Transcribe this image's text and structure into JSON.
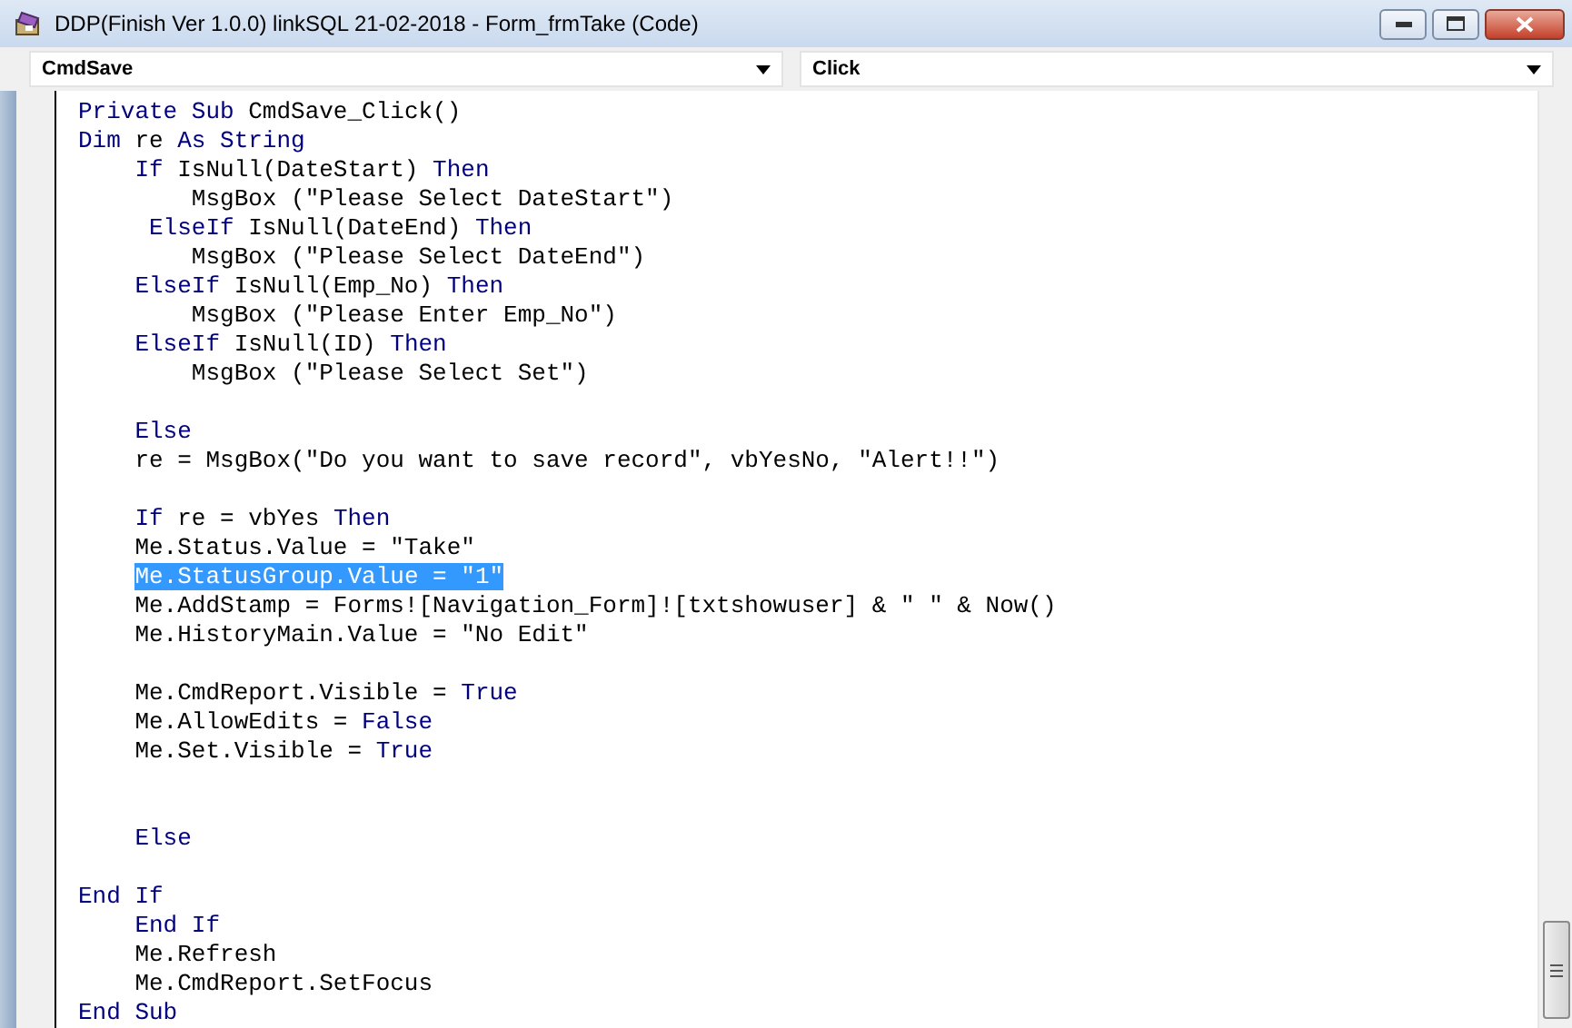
{
  "window": {
    "title": "DDP(Finish Ver 1.0.0) linkSQL 21-02-2018 - Form_frmTake (Code)"
  },
  "object_combo": {
    "value": "CmdSave"
  },
  "procedure_combo": {
    "value": "Click"
  },
  "code_lines": [
    {
      "kind": "code",
      "selected": false,
      "tokens": [
        {
          "text": "Private Sub",
          "kind": "keyword"
        },
        {
          "text": " CmdSave_Click()",
          "kind": "plain"
        }
      ]
    },
    {
      "kind": "code",
      "selected": false,
      "tokens": [
        {
          "text": "Dim",
          "kind": "keyword"
        },
        {
          "text": " re ",
          "kind": "plain"
        },
        {
          "text": "As String",
          "kind": "keyword"
        }
      ]
    },
    {
      "kind": "code",
      "selected": false,
      "tokens": [
        {
          "text": "    If",
          "kind": "keyword"
        },
        {
          "text": " IsNull(DateStart) ",
          "kind": "plain"
        },
        {
          "text": "Then",
          "kind": "keyword"
        }
      ]
    },
    {
      "kind": "code",
      "selected": false,
      "tokens": [
        {
          "text": "        MsgBox (\"Please Select DateStart\")",
          "kind": "plain"
        }
      ]
    },
    {
      "kind": "code",
      "selected": false,
      "tokens": [
        {
          "text": "     ElseIf",
          "kind": "keyword"
        },
        {
          "text": " IsNull(DateEnd) ",
          "kind": "plain"
        },
        {
          "text": "Then",
          "kind": "keyword"
        }
      ]
    },
    {
      "kind": "code",
      "selected": false,
      "tokens": [
        {
          "text": "        MsgBox (\"Please Select DateEnd\")",
          "kind": "plain"
        }
      ]
    },
    {
      "kind": "code",
      "selected": false,
      "tokens": [
        {
          "text": "    ElseIf",
          "kind": "keyword"
        },
        {
          "text": " IsNull(Emp_No) ",
          "kind": "plain"
        },
        {
          "text": "Then",
          "kind": "keyword"
        }
      ]
    },
    {
      "kind": "code",
      "selected": false,
      "tokens": [
        {
          "text": "        MsgBox (\"Please Enter Emp_No\")",
          "kind": "plain"
        }
      ]
    },
    {
      "kind": "code",
      "selected": false,
      "tokens": [
        {
          "text": "    ElseIf",
          "kind": "keyword"
        },
        {
          "text": " IsNull(ID) ",
          "kind": "plain"
        },
        {
          "text": "Then",
          "kind": "keyword"
        }
      ]
    },
    {
      "kind": "code",
      "selected": false,
      "tokens": [
        {
          "text": "        MsgBox (\"Please Select Set\")",
          "kind": "plain"
        }
      ]
    },
    {
      "kind": "blank"
    },
    {
      "kind": "code",
      "selected": false,
      "tokens": [
        {
          "text": "    Else",
          "kind": "keyword"
        }
      ]
    },
    {
      "kind": "code",
      "selected": false,
      "tokens": [
        {
          "text": "    re = MsgBox(\"Do you want to save record\", vbYesNo, \"Alert!!\")",
          "kind": "plain"
        }
      ]
    },
    {
      "kind": "blank"
    },
    {
      "kind": "code",
      "selected": false,
      "tokens": [
        {
          "text": "    If",
          "kind": "keyword"
        },
        {
          "text": " re = vbYes ",
          "kind": "plain"
        },
        {
          "text": "Then",
          "kind": "keyword"
        }
      ]
    },
    {
      "kind": "code",
      "selected": false,
      "tokens": [
        {
          "text": "    Me.Status.Value = \"Take\"",
          "kind": "plain"
        }
      ]
    },
    {
      "kind": "code",
      "selected": true,
      "tokens": [
        {
          "text": "    Me.StatusGroup.Value = \"1\"",
          "kind": "plain"
        }
      ]
    },
    {
      "kind": "code",
      "selected": false,
      "tokens": [
        {
          "text": "    Me.AddStamp = Forms![Navigation_Form]![txtshowuser] & \" \" & Now()",
          "kind": "plain"
        }
      ]
    },
    {
      "kind": "code",
      "selected": false,
      "tokens": [
        {
          "text": "    Me.HistoryMain.Value = \"No Edit\"",
          "kind": "plain"
        }
      ]
    },
    {
      "kind": "blank"
    },
    {
      "kind": "code",
      "selected": false,
      "tokens": [
        {
          "text": "    Me.CmdReport.Visible = ",
          "kind": "plain"
        },
        {
          "text": "True",
          "kind": "keyword"
        }
      ]
    },
    {
      "kind": "code",
      "selected": false,
      "tokens": [
        {
          "text": "    Me.AllowEdits = ",
          "kind": "plain"
        },
        {
          "text": "False",
          "kind": "keyword"
        }
      ]
    },
    {
      "kind": "code",
      "selected": false,
      "tokens": [
        {
          "text": "    Me.Set.Visible = ",
          "kind": "plain"
        },
        {
          "text": "True",
          "kind": "keyword"
        }
      ]
    },
    {
      "kind": "blank"
    },
    {
      "kind": "blank"
    },
    {
      "kind": "code",
      "selected": false,
      "tokens": [
        {
          "text": "    Else",
          "kind": "keyword"
        }
      ]
    },
    {
      "kind": "blank"
    },
    {
      "kind": "code",
      "selected": false,
      "tokens": [
        {
          "text": "End If",
          "kind": "keyword"
        }
      ]
    },
    {
      "kind": "code",
      "selected": false,
      "tokens": [
        {
          "text": "    End If",
          "kind": "keyword"
        }
      ]
    },
    {
      "kind": "code",
      "selected": false,
      "tokens": [
        {
          "text": "    Me.Refresh",
          "kind": "plain"
        }
      ]
    },
    {
      "kind": "code",
      "selected": false,
      "tokens": [
        {
          "text": "    Me.CmdReport.SetFocus",
          "kind": "plain"
        }
      ]
    },
    {
      "kind": "code",
      "selected": false,
      "tokens": [
        {
          "text": "End Sub",
          "kind": "keyword"
        }
      ]
    }
  ]
}
